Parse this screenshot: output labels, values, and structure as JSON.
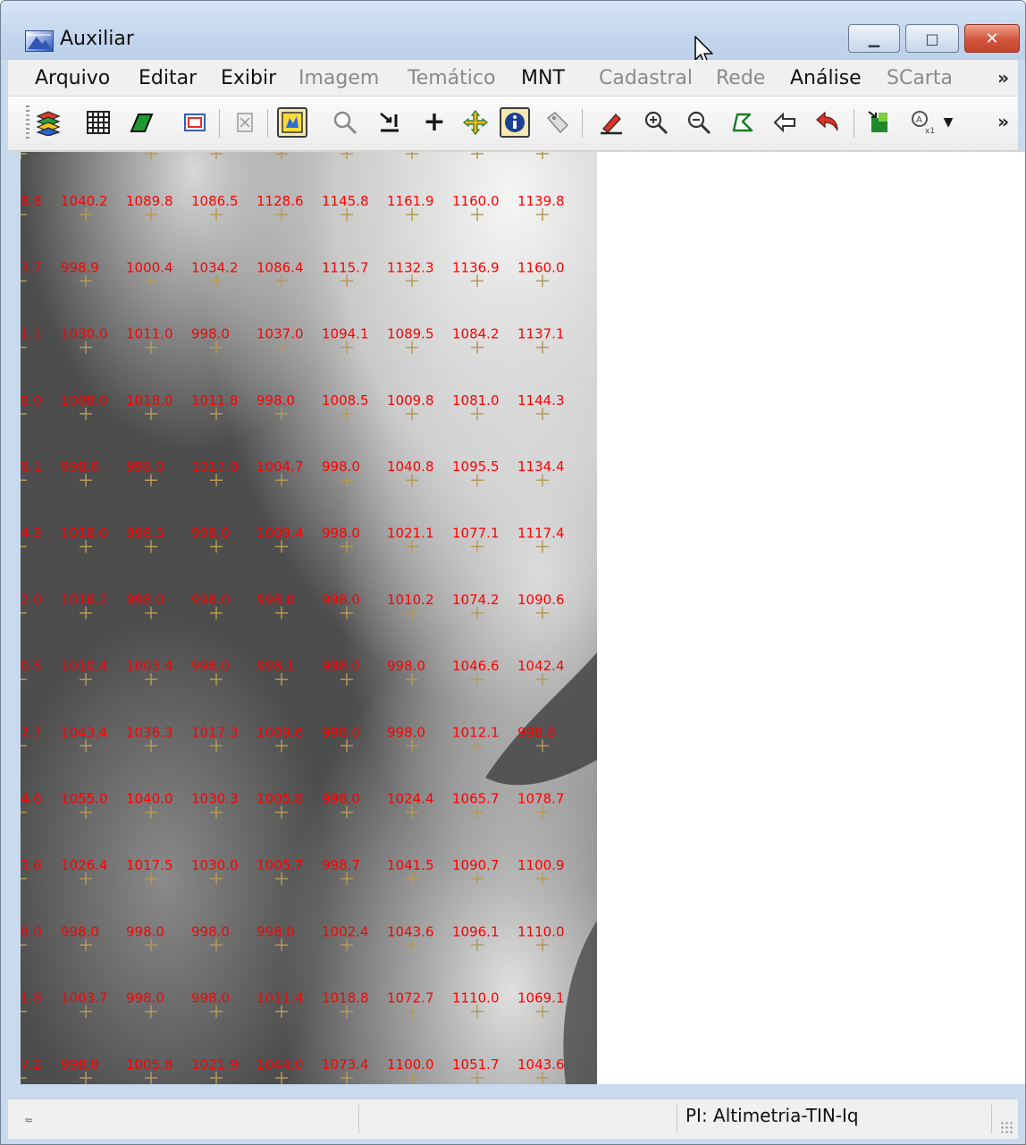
{
  "window": {
    "title": "Auxiliar"
  },
  "menu": [
    {
      "label": "Arquivo",
      "enabled": true
    },
    {
      "label": "Editar",
      "enabled": true
    },
    {
      "label": "Exibir",
      "enabled": true
    },
    {
      "label": "Imagem",
      "enabled": false
    },
    {
      "label": "Temático",
      "enabled": false
    },
    {
      "label": "MNT",
      "enabled": true
    },
    {
      "label": "Cadastral",
      "enabled": false
    },
    {
      "label": "Rede",
      "enabled": false
    },
    {
      "label": "Análise",
      "enabled": true
    },
    {
      "label": "SCarta",
      "enabled": false
    }
  ],
  "menu_overflow": "»",
  "toolbar_overflow": "»",
  "toolbar": [
    "layers-icon",
    "grid-icon",
    "polygon-fill-icon",
    "rectangle-frame-icon",
    "disabled-tool-icon",
    "select-object-icon",
    "search-icon",
    "snap-icon",
    "crosshair-icon",
    "pan-icon",
    "info-icon",
    "tag-icon",
    "edit-pencil-icon",
    "zoom-in-icon",
    "zoom-out-icon",
    "zoom-area-icon",
    "back-arrow-icon",
    "undo-icon",
    "export-icon",
    "scale-icon",
    "dropdown-arrow-icon"
  ],
  "grid_values": [
    [
      "8.8",
      "1040.2",
      "1089.8",
      "1086.5",
      "1128.6",
      "1145.8",
      "1161.9",
      "1160.0",
      "1139.8"
    ],
    [
      "3.7",
      "998.9",
      "1000.4",
      "1034.2",
      "1086.4",
      "1115.7",
      "1132.3",
      "1136.9",
      "1160.0"
    ],
    [
      "1.1",
      "1030.0",
      "1011.0",
      "998.0",
      "1037.0",
      "1094.1",
      "1089.5",
      "1084.2",
      "1137.1"
    ],
    [
      "8.0",
      "1008.0",
      "1018.0",
      "1011.8",
      "998.0",
      "1008.5",
      "1009.8",
      "1081.0",
      "1144.3"
    ],
    [
      "8.1",
      "998.0",
      "998.0",
      "1017.0",
      "1004.7",
      "998.0",
      "1040.8",
      "1095.5",
      "1134.4"
    ],
    [
      "4.3",
      "1018.0",
      "998.5",
      "998.0",
      "1009.4",
      "998.0",
      "1021.1",
      "1077.1",
      "1117.4"
    ],
    [
      "2.0",
      "1018.2",
      "998.0",
      "998.0",
      "998.0",
      "998.0",
      "1010.2",
      "1074.2",
      "1090.6"
    ],
    [
      "0.5",
      "1010.4",
      "1003.4",
      "998.0",
      "998.1",
      "998.0",
      "998.0",
      "1046.6",
      "1042.4"
    ],
    [
      "7.7",
      "1043.4",
      "1036.3",
      "1017.3",
      "1009.6",
      "998.0",
      "998.0",
      "1012.1",
      "998.8"
    ],
    [
      "4.6",
      "1055.0",
      "1040.0",
      "1030.3",
      "1005.8",
      "998.0",
      "1024.4",
      "1065.7",
      "1078.7"
    ],
    [
      "3.6",
      "1026.4",
      "1017.5",
      "1030.0",
      "1005.7",
      "998.7",
      "1041.5",
      "1090.7",
      "1100.9"
    ],
    [
      "8.0",
      "998.0",
      "998.0",
      "998.0",
      "998.0",
      "1002.4",
      "1043.6",
      "1096.1",
      "1110.0"
    ],
    [
      "1.8",
      "1003.7",
      "998.0",
      "998.0",
      "1011.4",
      "1018.8",
      "1072.7",
      "1110.0",
      "1069.1"
    ],
    [
      "7.2",
      "998.0",
      "1005.8",
      "1021.9",
      "1044.0",
      "1073.4",
      "1100.0",
      "1051.7",
      "1043.6"
    ]
  ],
  "colors": {
    "grid_label": "#ff0000",
    "grid_marker": "#b59a55"
  },
  "status": {
    "left_icon": "≈",
    "pi_label": "PI: Altimetria-TIN-Iq"
  }
}
